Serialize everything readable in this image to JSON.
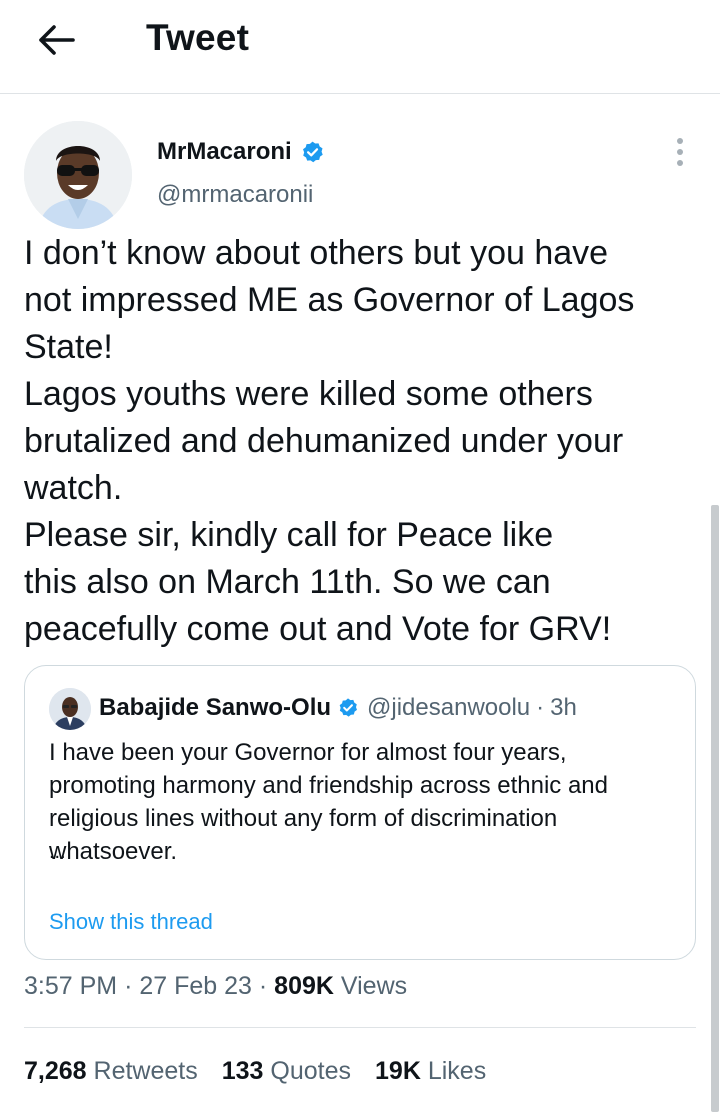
{
  "header": {
    "title": "Tweet",
    "back_icon": "arrow-left-icon"
  },
  "tweet": {
    "author_name": "MrMacaroni",
    "author_handle": "@mrmacaronii",
    "verified": true,
    "text_lines": [
      "I don’t know about others but you have",
      "not impressed ME as Governor of Lagos",
      "State!",
      "Lagos youths were killed some others",
      "brutalized and dehumanized under your",
      "watch.",
      "Please sir, kindly call for Peace like",
      "this also on March 11th. So we can",
      "peacefully come out and Vote for GRV!"
    ],
    "time": "3:57 PM",
    "date": "27 Feb 23",
    "views_count": "809K",
    "views_label": "Views",
    "separator": "·"
  },
  "quote": {
    "author_name": "Babajide Sanwo-Olu",
    "author_handle": "@jidesanwoolu",
    "separator": "·",
    "time_ago": "3h",
    "text_lines": [
      "I have been your Governor for almost four years,",
      "promoting harmony and friendship across ethnic and",
      "religious lines without any form of discrimination",
      "whatsoever."
    ],
    "ellipsis": "...",
    "show_thread": "Show this thread"
  },
  "stats": {
    "retweets_count": "7,268",
    "retweets_label": "Retweets",
    "quotes_count": "133",
    "quotes_label": "Quotes",
    "likes_count": "19K",
    "likes_label": "Likes"
  },
  "colors": {
    "accent": "#1d9bf0",
    "text": "#0f1419",
    "secondary_text": "#536471",
    "border": "#cfd9de"
  }
}
